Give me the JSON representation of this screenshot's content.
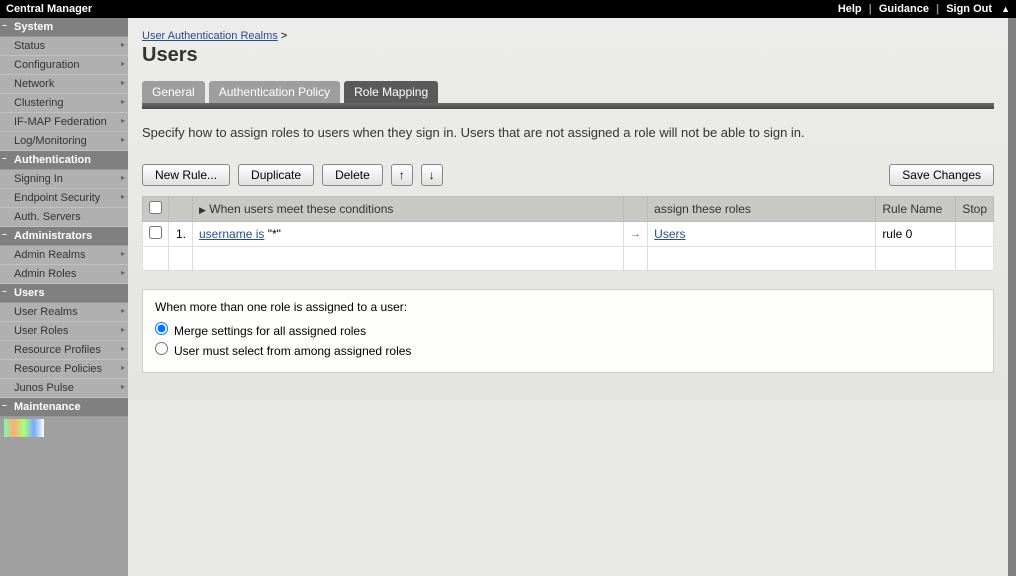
{
  "topbar": {
    "title": "Central Manager",
    "help": "Help",
    "guidance": "Guidance",
    "signout": "Sign Out"
  },
  "sidebar": {
    "sections": [
      {
        "label": "System",
        "items": [
          "Status",
          "Configuration",
          "Network",
          "Clustering",
          "IF-MAP Federation",
          "Log/Monitoring"
        ]
      },
      {
        "label": "Authentication",
        "items": [
          "Signing In",
          "Endpoint Security",
          "Auth. Servers"
        ]
      },
      {
        "label": "Administrators",
        "items": [
          "Admin Realms",
          "Admin Roles"
        ]
      },
      {
        "label": "Users",
        "items": [
          "User Realms",
          "User Roles",
          "Resource Profiles",
          "Resource Policies",
          "Junos Pulse"
        ]
      },
      {
        "label": "Maintenance",
        "items": []
      }
    ]
  },
  "breadcrumb": {
    "link": "User Authentication Realms",
    "sep": ">"
  },
  "page_title": "Users",
  "tabs": {
    "t0": "General",
    "t1": "Authentication Policy",
    "t2": "Role Mapping"
  },
  "instructions": "Specify how to assign roles to users when they sign in. Users that are not assigned a role will not be able to sign in.",
  "buttons": {
    "new_rule": "New Rule...",
    "dup": "Duplicate",
    "del": "Delete",
    "up": "↑",
    "down": "↓",
    "save": "Save Changes"
  },
  "table": {
    "h_cond": "When users meet these conditions",
    "h_assign": "assign these roles",
    "h_name": "Rule Name",
    "h_stop": "Stop",
    "rows": [
      {
        "num": "1.",
        "cond_link": "username is",
        "cond_rest": " \"*\"",
        "assign": "Users",
        "name": "rule 0"
      }
    ]
  },
  "role_assign": {
    "q": "When more than one role is assigned to a user:",
    "opt1": "Merge settings for all assigned roles",
    "opt2": "User must select from among assigned roles"
  }
}
